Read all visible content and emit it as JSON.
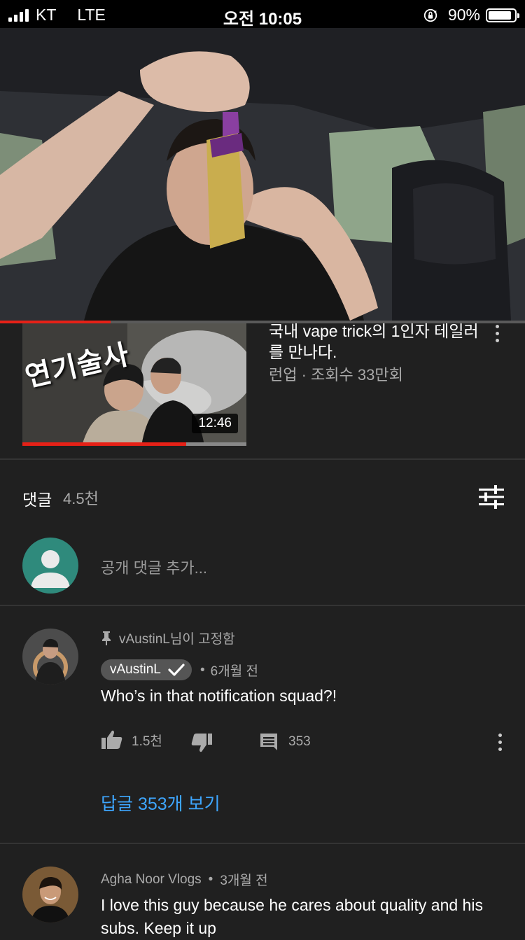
{
  "status_bar": {
    "carrier": "KT",
    "network": "LTE",
    "time": "오전 10:05",
    "battery_text": "90%",
    "battery_level": 0.9
  },
  "player": {
    "progress_fraction": 0.21
  },
  "next_video": {
    "title": "국내 vape trick의 1인자 테일러를 만나다.",
    "meta": "런업 · 조회수 33만회",
    "duration": "12:46",
    "thumbnail_text": "연기술사",
    "watched_fraction": 0.73
  },
  "comments_header": {
    "label": "댓글",
    "count": "4.5천"
  },
  "add_comment": {
    "placeholder": "공개 댓글 추가..."
  },
  "comments": [
    {
      "pinned_text": "vAustinL님이 고정함",
      "author": "vAustinL",
      "age": "6개월 전",
      "text": "Who’s in that notification squad?!",
      "likes": "1.5천",
      "reply_count": "353",
      "view_replies": "답글 353개 보기"
    },
    {
      "author": "Agha Noor Vlogs",
      "age": "3개월 전",
      "text_line1": "I love this guy because he cares about quality and his",
      "text_line2": "subs. Keep it up"
    }
  ],
  "colors": {
    "background": "#202020",
    "accent_red": "#e62117",
    "link_blue": "#3ea6ff",
    "secondary_text": "#aaaaaa"
  }
}
